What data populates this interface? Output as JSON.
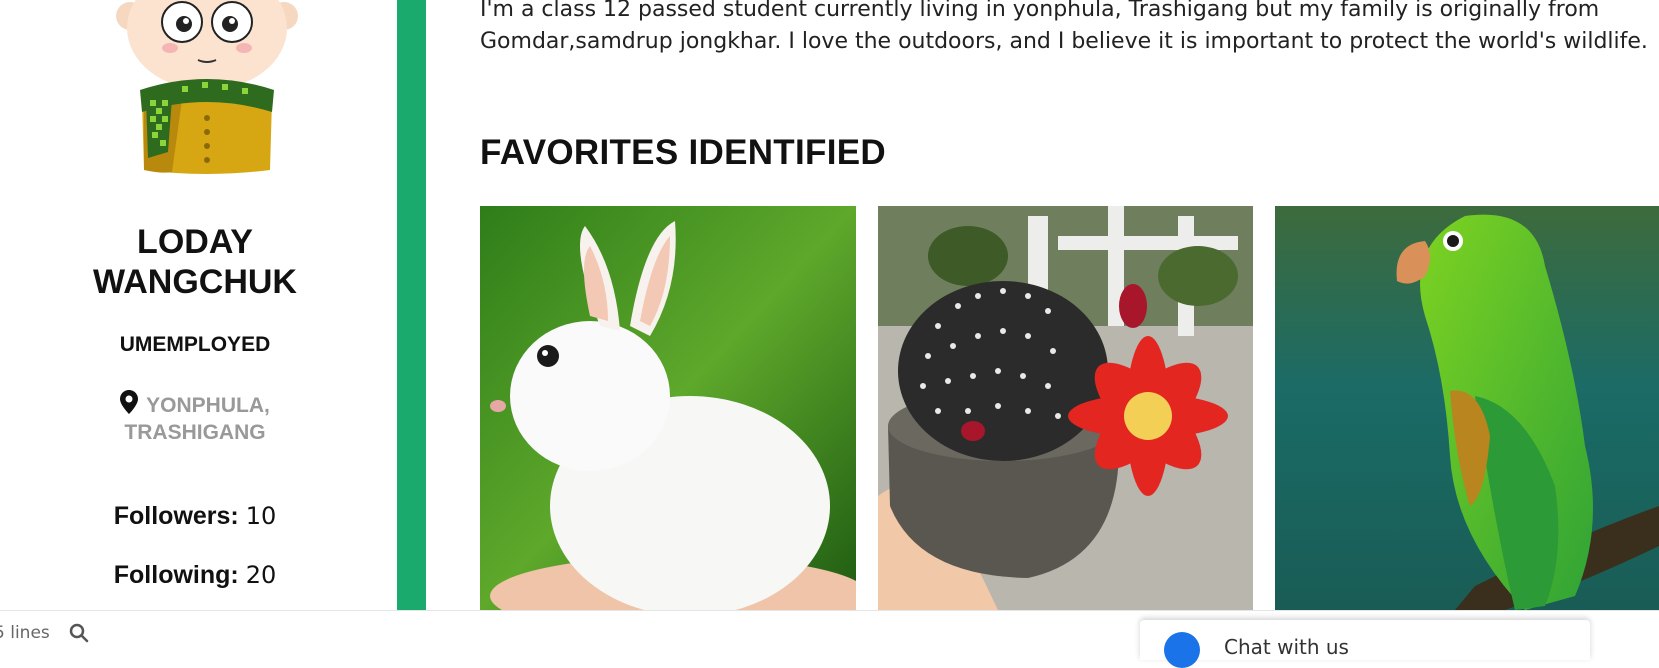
{
  "profile": {
    "name": "LODAY WANGCHUK",
    "job": "UMEMPLOYED",
    "location": "YONPHULA, TRASHIGANG",
    "followers_label": "Followers:",
    "followers_count": "10",
    "following_label": "Following:",
    "following_count": "20"
  },
  "bio": "I'm a class 12 passed student currently living in yonphula, Trashigang but my family is originally from Gomdar,samdrup jongkhar. I love the outdoors, and I believe it is important to protect the world's wildlife.",
  "favorites": {
    "title": "FAVORITES IDENTIFIED",
    "items": [
      "rabbit",
      "cactus",
      "parrot"
    ]
  },
  "bottombar": {
    "lines_label": "5 lines",
    "chat_label": "Chat with us"
  },
  "colors": {
    "accent": "#1aaa6e",
    "location": "#999999"
  }
}
